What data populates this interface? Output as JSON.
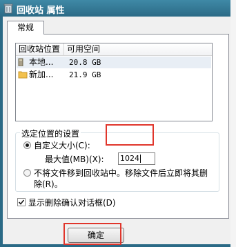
{
  "titlebar": {
    "title": "回收站 属性"
  },
  "tabs": [
    {
      "label": "常规"
    }
  ],
  "listview": {
    "columns": [
      "回收站位置",
      "可用空间"
    ],
    "rows": [
      {
        "name": "本地...",
        "space": "20.8 GB",
        "selected": true
      },
      {
        "name": "新加...",
        "space": "21.9 GB",
        "selected": false
      }
    ]
  },
  "settings": {
    "group_title": "选定位置的设置",
    "custom_size_label": "自定义大小(C):",
    "max_value_label": "最大值(MB)(X):",
    "max_value": "1024",
    "no_move_label_line1": "不将文件移到回收站中。移除文件后立即将其删",
    "no_move_label_line2": "除(R)。",
    "confirm_dialog_label": "显示删除确认对话框(D)",
    "custom_size_selected": true,
    "confirm_dialog_checked": true
  },
  "buttons": {
    "ok_label": "确定"
  },
  "colors": {
    "titlebar": "#2b6a86",
    "highlight": "#e0352b"
  }
}
